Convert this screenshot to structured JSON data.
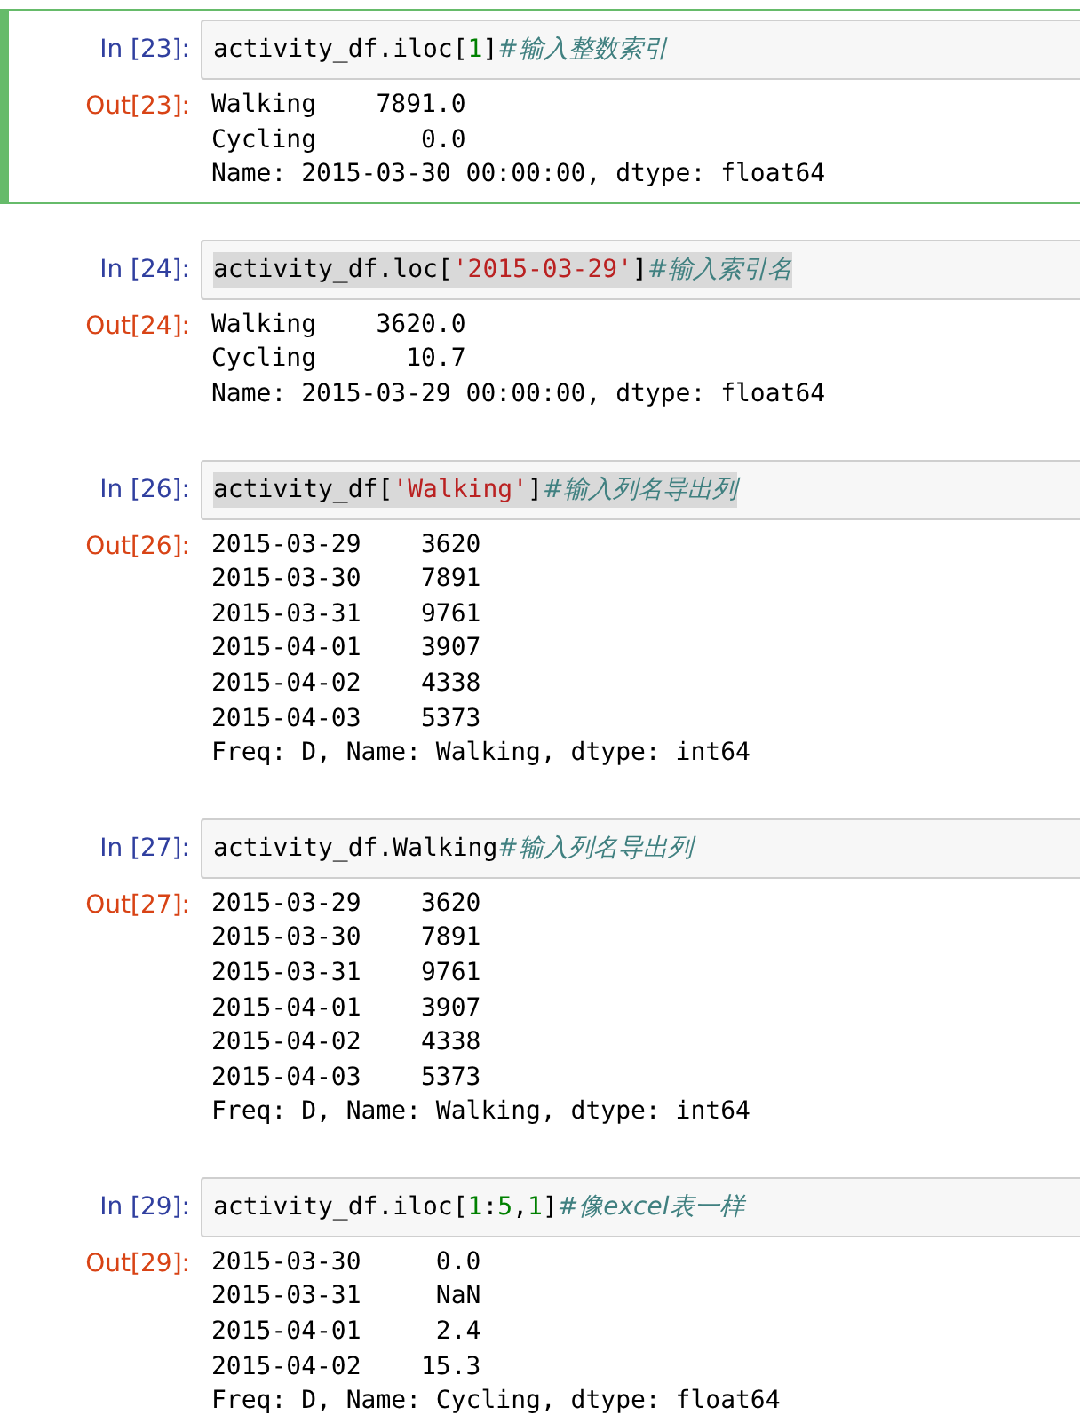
{
  "cells": [
    {
      "prompt": "In [23]:",
      "selected": true,
      "highlighted": false,
      "code": [
        {
          "kind": "plain",
          "text": "activity_df.iloc["
        },
        {
          "kind": "number",
          "text": "1"
        },
        {
          "kind": "plain",
          "text": "]"
        },
        {
          "kind": "comment",
          "text": "#输入整数索引"
        }
      ],
      "out_prompt": "Out[23]:",
      "output": [
        "Walking    7891.0",
        "Cycling       0.0",
        "Name: 2015-03-30 00:00:00, dtype: float64"
      ]
    },
    {
      "prompt": "In [24]:",
      "selected": false,
      "highlighted": true,
      "code": [
        {
          "kind": "plain",
          "text": "activity_df.loc["
        },
        {
          "kind": "string",
          "text": "'2015-03-29'"
        },
        {
          "kind": "plain",
          "text": "]"
        },
        {
          "kind": "comment",
          "text": "#输入索引名"
        }
      ],
      "out_prompt": "Out[24]:",
      "output": [
        "Walking    3620.0",
        "Cycling      10.7",
        "Name: 2015-03-29 00:00:00, dtype: float64"
      ]
    },
    {
      "prompt": "In [26]:",
      "selected": false,
      "highlighted": true,
      "code": [
        {
          "kind": "plain",
          "text": "activity_df["
        },
        {
          "kind": "string",
          "text": "'Walking'"
        },
        {
          "kind": "plain",
          "text": "]"
        },
        {
          "kind": "comment",
          "text": "#输入列名导出列"
        }
      ],
      "out_prompt": "Out[26]:",
      "output": [
        "2015-03-29    3620",
        "2015-03-30    7891",
        "2015-03-31    9761",
        "2015-04-01    3907",
        "2015-04-02    4338",
        "2015-04-03    5373",
        "Freq: D, Name: Walking, dtype: int64"
      ]
    },
    {
      "prompt": "In [27]:",
      "selected": false,
      "highlighted": false,
      "code": [
        {
          "kind": "plain",
          "text": "activity_df.Walking"
        },
        {
          "kind": "comment",
          "text": "#输入列名导出列"
        }
      ],
      "out_prompt": "Out[27]:",
      "output": [
        "2015-03-29    3620",
        "2015-03-30    7891",
        "2015-03-31    9761",
        "2015-04-01    3907",
        "2015-04-02    4338",
        "2015-04-03    5373",
        "Freq: D, Name: Walking, dtype: int64"
      ]
    },
    {
      "prompt": "In [29]:",
      "selected": false,
      "highlighted": false,
      "code": [
        {
          "kind": "plain",
          "text": "activity_df.iloc["
        },
        {
          "kind": "number",
          "text": "1"
        },
        {
          "kind": "plain",
          "text": ":"
        },
        {
          "kind": "number",
          "text": "5"
        },
        {
          "kind": "plain",
          "text": ","
        },
        {
          "kind": "number",
          "text": "1"
        },
        {
          "kind": "plain",
          "text": "]"
        },
        {
          "kind": "comment",
          "text": "#像excel表一样"
        }
      ],
      "out_prompt": "Out[29]:",
      "output": [
        "2015-03-30     0.0",
        "2015-03-31     NaN",
        "2015-04-01     2.4",
        "2015-04-02    15.3",
        "Freq: D, Name: Cycling, dtype: float64"
      ]
    }
  ]
}
